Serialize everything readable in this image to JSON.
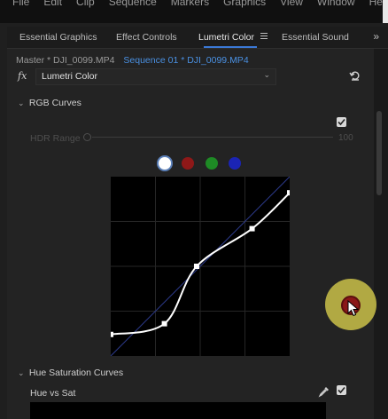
{
  "menubar": {
    "items": [
      "File",
      "Edit",
      "Clip",
      "Sequence",
      "Markers",
      "Graphics",
      "View",
      "Window",
      "Help"
    ]
  },
  "tabs": {
    "items": [
      {
        "label": "Essential Graphics"
      },
      {
        "label": "Effect Controls"
      },
      {
        "label": "Lumetri Color",
        "active": true
      },
      {
        "label": "Essential Sound"
      }
    ],
    "overflow_icon": "double-chevron-right-icon",
    "menu_icon": "hamburger-icon"
  },
  "clip": {
    "master": "Master * DJI_0099.MP4",
    "sequence": "Sequence 01 * DJI_0099.MP4"
  },
  "effect": {
    "fx_label": "fx",
    "selected": "Lumetri Color",
    "reset_icon": "reset-icon"
  },
  "rgb_curves": {
    "title": "RGB Curves",
    "enabled": true,
    "hdr_range_label": "HDR Range",
    "hdr_range_value": "100",
    "channels": [
      {
        "name": "luma",
        "color": "#ffffff",
        "selected": true
      },
      {
        "name": "red",
        "color": "#8e1818"
      },
      {
        "name": "green",
        "color": "#1e8a25"
      },
      {
        "name": "blue",
        "color": "#1b24b4"
      }
    ],
    "curve_points": [
      [
        0,
        0.12
      ],
      [
        0.3,
        0.18
      ],
      [
        0.48,
        0.5
      ],
      [
        0.79,
        0.71
      ],
      [
        1,
        0.91
      ]
    ]
  },
  "hue_saturation_curves": {
    "title": "Hue Saturation Curves",
    "hue_vs_sat_label": "Hue vs Sat",
    "enabled": true,
    "eyedropper_icon": "eyedropper-icon"
  },
  "colors": {
    "accent": "#3b79d6",
    "link": "#4a90e2",
    "cursor_highlight": "#bcb446"
  }
}
